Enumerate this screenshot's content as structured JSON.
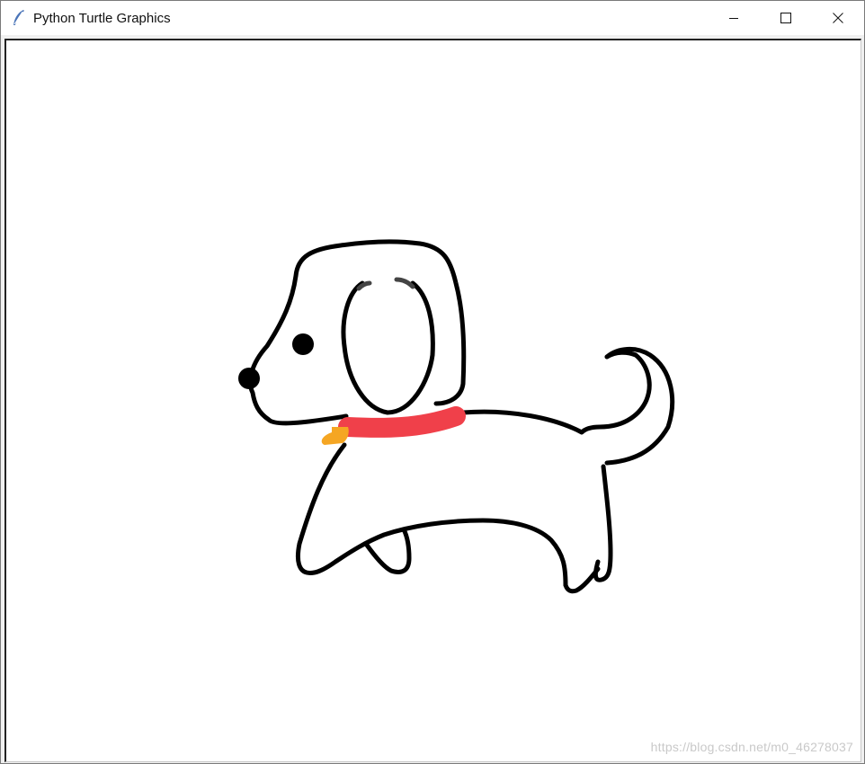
{
  "window": {
    "title": "Python Turtle Graphics",
    "app_icon": "feather-icon",
    "controls": [
      "minimize-icon",
      "maximize-icon",
      "close-icon"
    ]
  },
  "canvas": {
    "background": "#ffffff",
    "drawing": "dog",
    "stroke_color": "#000000",
    "collar_color": "#f0404a",
    "tag_color": "#f5a623",
    "eyebrow_color": "#444444"
  },
  "watermark": "https://blog.csdn.net/m0_46278037"
}
